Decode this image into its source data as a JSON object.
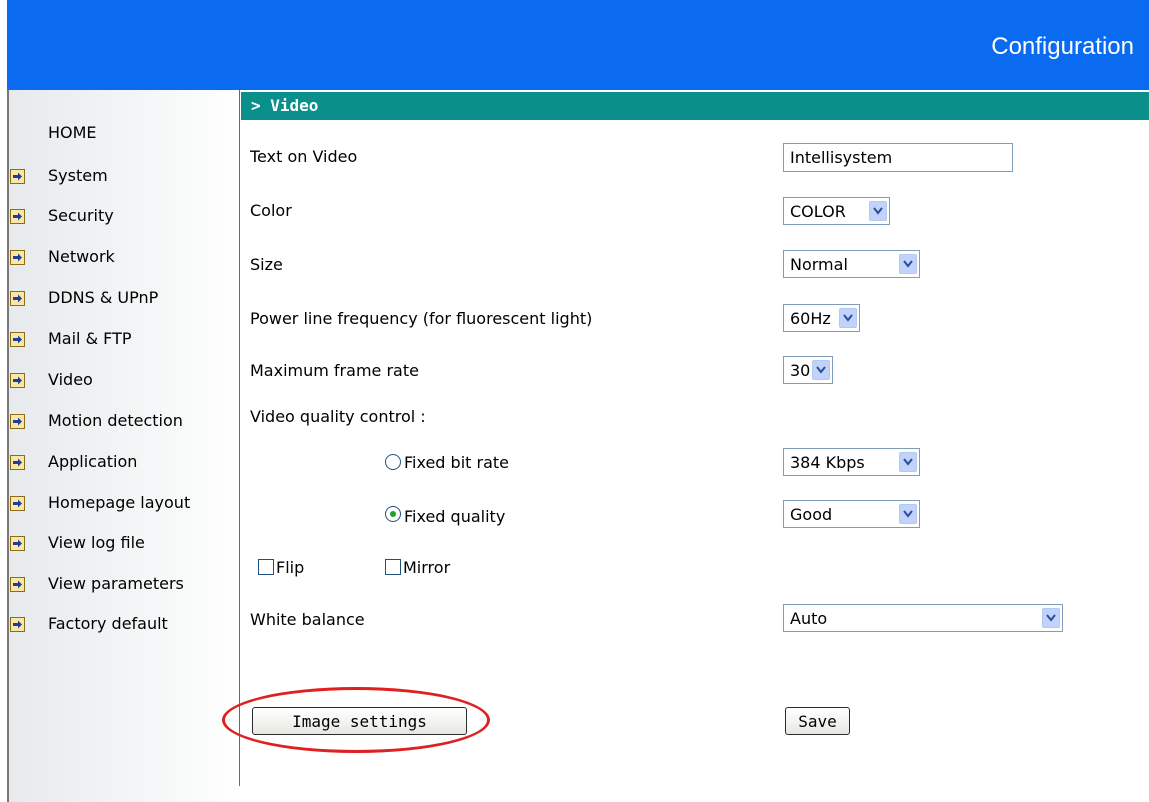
{
  "header": {
    "title": "Configuration"
  },
  "sidebar": {
    "home": "HOME",
    "items": [
      {
        "label": "System"
      },
      {
        "label": "Security"
      },
      {
        "label": "Network"
      },
      {
        "label": "DDNS & UPnP"
      },
      {
        "label": "Mail & FTP"
      },
      {
        "label": "Video"
      },
      {
        "label": "Motion detection"
      },
      {
        "label": "Application"
      },
      {
        "label": "Homepage layout"
      },
      {
        "label": "View log file"
      },
      {
        "label": "View parameters"
      },
      {
        "label": "Factory default"
      }
    ],
    "item_icon": "arrow-right-icon"
  },
  "section": {
    "title": "> Video"
  },
  "form": {
    "text_on_video": {
      "label": "Text on Video",
      "value": "Intellisystem"
    },
    "color": {
      "label": "Color",
      "value": "COLOR"
    },
    "size": {
      "label": "Size",
      "value": "Normal"
    },
    "power_line": {
      "label": "Power line frequency (for fluorescent light)",
      "value": "60Hz"
    },
    "max_frame_rate": {
      "label": "Maximum frame rate",
      "value": "30"
    },
    "quality_control": {
      "label": "Video quality control :"
    },
    "fixed_bit_rate": {
      "label": "Fixed bit rate",
      "value": "384 Kbps",
      "selected": false
    },
    "fixed_quality": {
      "label": "Fixed quality",
      "value": "Good",
      "selected": true
    },
    "flip": {
      "label": "Flip",
      "checked": false
    },
    "mirror": {
      "label": "Mirror",
      "checked": false
    },
    "white_balance": {
      "label": "White balance",
      "value": "Auto"
    }
  },
  "buttons": {
    "image_settings": "Image settings",
    "save": "Save"
  },
  "colors": {
    "header": "#0a6bf0",
    "section_bar": "#0b8f8b",
    "highlight_ellipse": "#e02020",
    "radio_dot": "#21a121"
  }
}
